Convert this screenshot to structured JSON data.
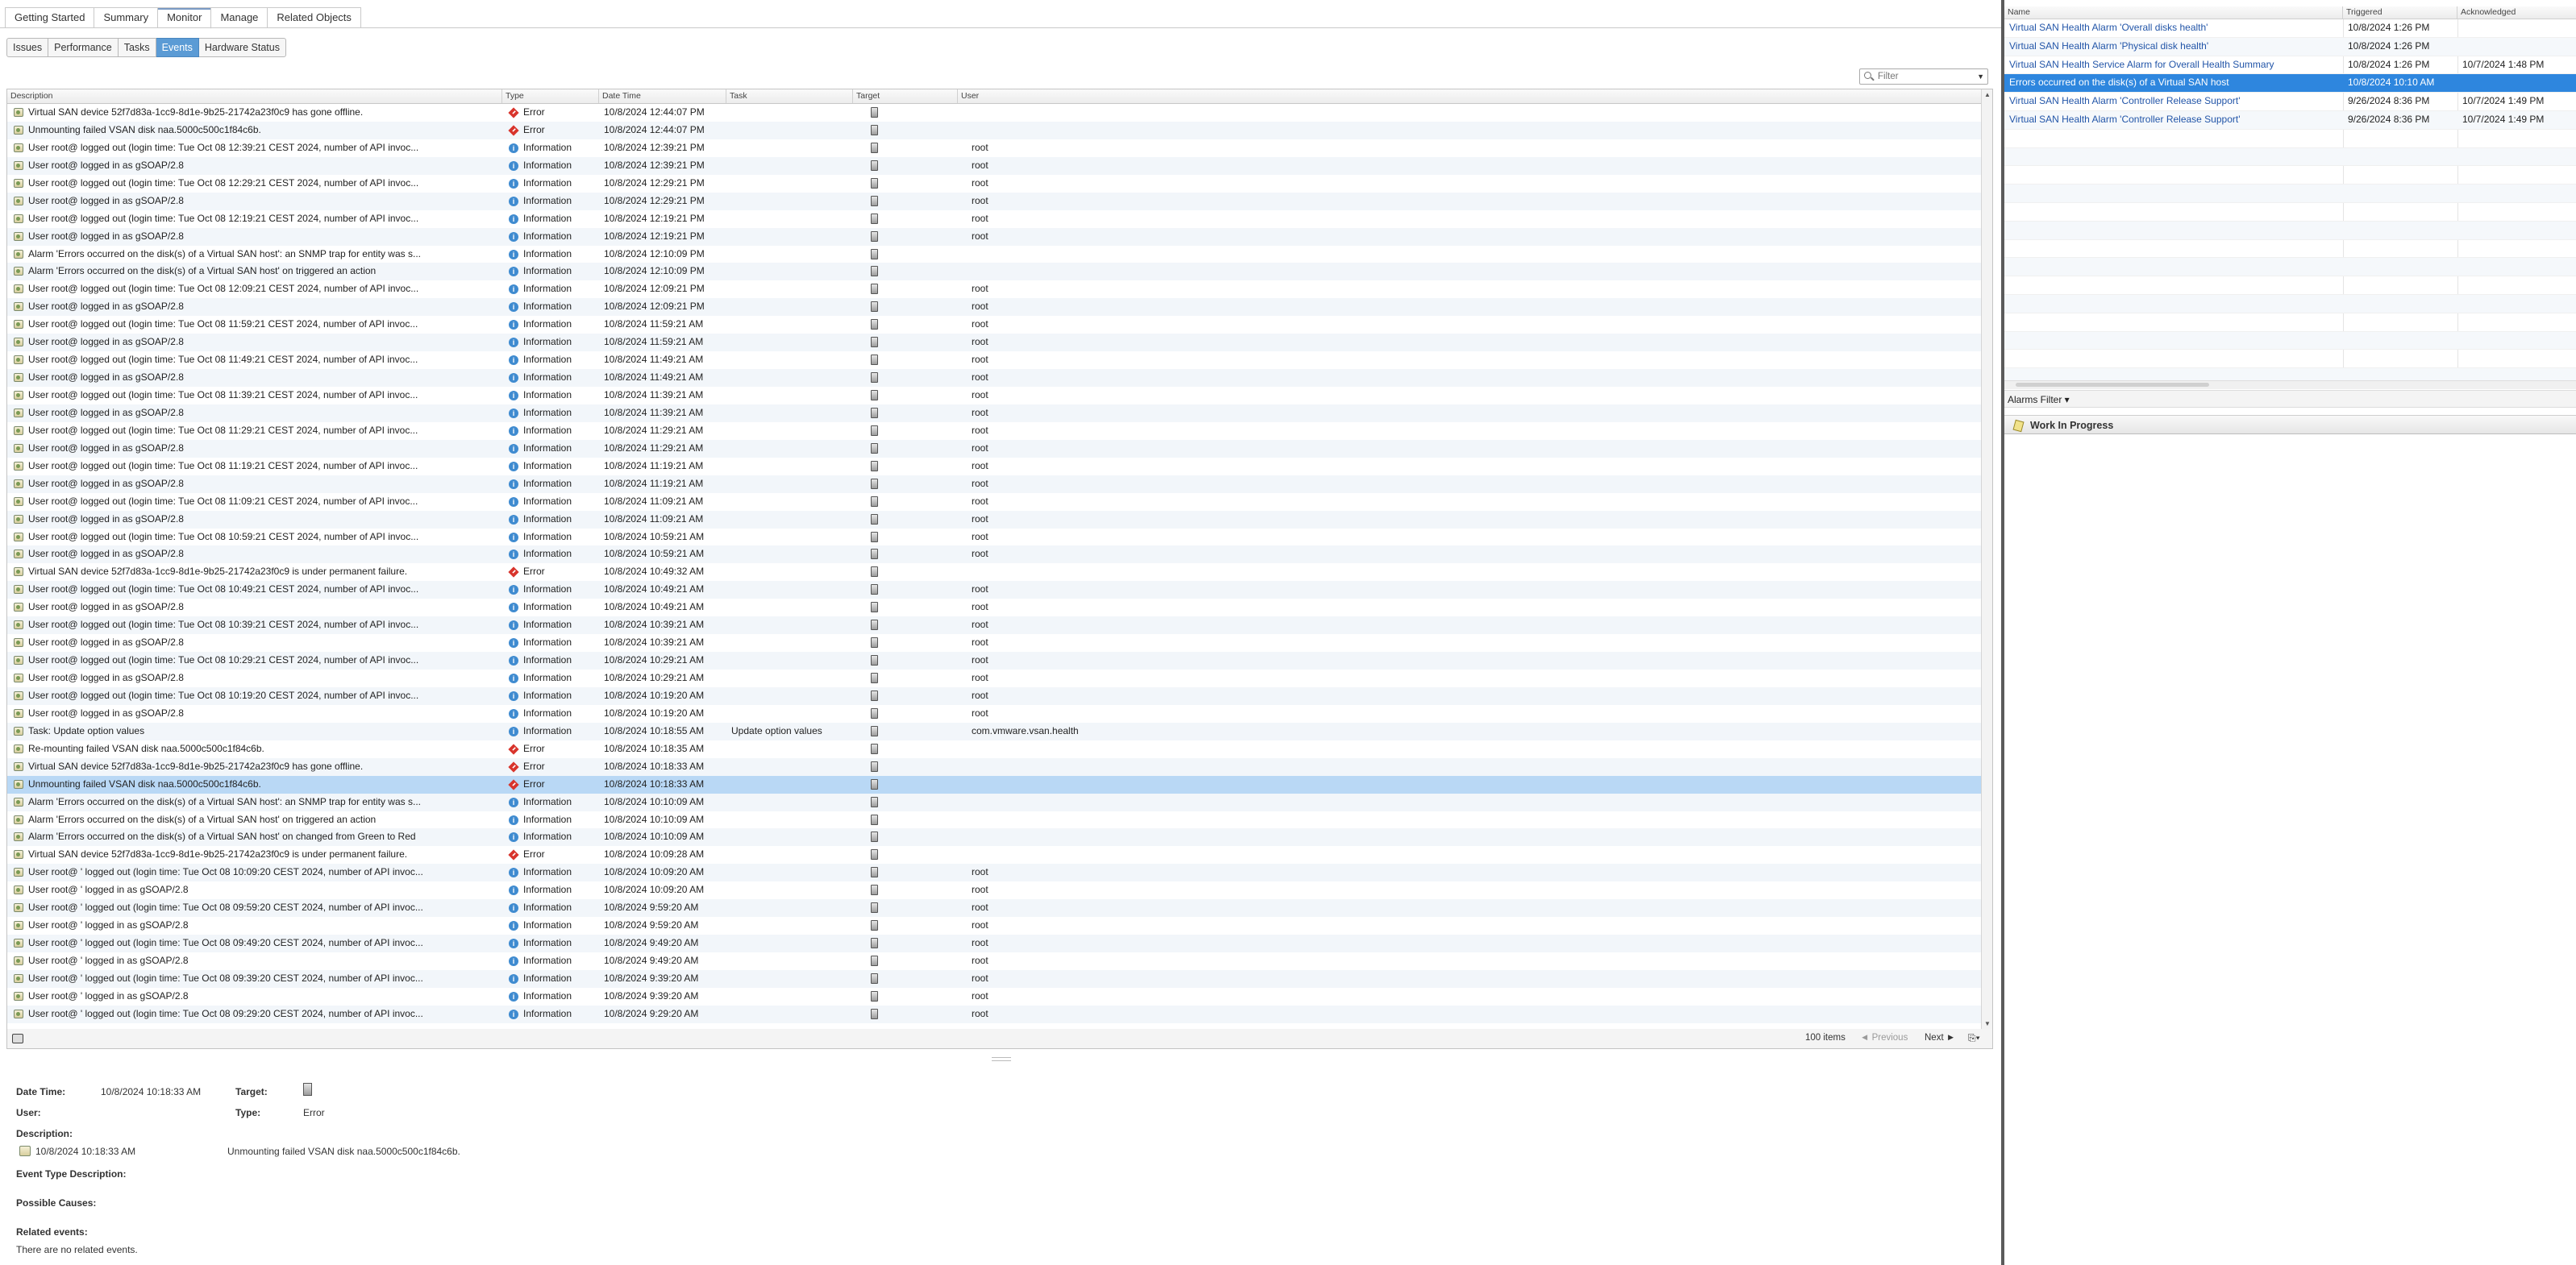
{
  "top_tabs": [
    "Getting Started",
    "Summary",
    "Monitor",
    "Manage",
    "Related Objects"
  ],
  "active_top_tab": "Monitor",
  "sub_tabs": [
    "Issues",
    "Performance",
    "Tasks",
    "Events",
    "Hardware Status"
  ],
  "active_sub_tab": "Events",
  "filter": {
    "placeholder": "Filter"
  },
  "events": {
    "columns": [
      "Description",
      "Type",
      "Date Time",
      "Task",
      "Target",
      "User"
    ],
    "rows": [
      {
        "desc": "Virtual SAN device 52f7d83a-1cc9-8d1e-9b25-21742a23f0c9 has gone offline.",
        "type": "Error",
        "date": "10/8/2024 12:44:07 PM",
        "task": "",
        "user": ""
      },
      {
        "desc": "Unmounting failed VSAN disk naa.5000c500c1f84c6b.",
        "type": "Error",
        "date": "10/8/2024 12:44:07 PM",
        "task": "",
        "user": ""
      },
      {
        "desc": "User root@                              logged out (login time: Tue Oct 08 12:39:21 CEST 2024, number of API invoc...",
        "type": "Information",
        "date": "10/8/2024 12:39:21 PM",
        "task": "",
        "user": "root"
      },
      {
        "desc": "User root@                              logged in as gSOAP/2.8",
        "type": "Information",
        "date": "10/8/2024 12:39:21 PM",
        "task": "",
        "user": "root"
      },
      {
        "desc": "User root@                              logged out (login time: Tue Oct 08 12:29:21 CEST 2024, number of API invoc...",
        "type": "Information",
        "date": "10/8/2024 12:29:21 PM",
        "task": "",
        "user": "root"
      },
      {
        "desc": "User root@                              logged in as gSOAP/2.8",
        "type": "Information",
        "date": "10/8/2024 12:29:21 PM",
        "task": "",
        "user": "root"
      },
      {
        "desc": "User root@                              logged out (login time: Tue Oct 08 12:19:21 CEST 2024, number of API invoc...",
        "type": "Information",
        "date": "10/8/2024 12:19:21 PM",
        "task": "",
        "user": "root"
      },
      {
        "desc": "User root@                              logged in as gSOAP/2.8",
        "type": "Information",
        "date": "10/8/2024 12:19:21 PM",
        "task": "",
        "user": "root"
      },
      {
        "desc": "Alarm 'Errors occurred on the disk(s) of a Virtual SAN host': an SNMP trap for entity                          was s...",
        "type": "Information",
        "date": "10/8/2024 12:10:09 PM",
        "task": "",
        "user": ""
      },
      {
        "desc": "Alarm 'Errors occurred on the disk(s) of a Virtual SAN host' on                              triggered an action",
        "type": "Information",
        "date": "10/8/2024 12:10:09 PM",
        "task": "",
        "user": ""
      },
      {
        "desc": "User root@                              logged out (login time: Tue Oct 08 12:09:21 CEST 2024, number of API invoc...",
        "type": "Information",
        "date": "10/8/2024 12:09:21 PM",
        "task": "",
        "user": "root"
      },
      {
        "desc": "User root@                              logged in as gSOAP/2.8",
        "type": "Information",
        "date": "10/8/2024 12:09:21 PM",
        "task": "",
        "user": "root"
      },
      {
        "desc": "User root@                              logged out (login time: Tue Oct 08 11:59:21 CEST 2024, number of API invoc...",
        "type": "Information",
        "date": "10/8/2024 11:59:21 AM",
        "task": "",
        "user": "root"
      },
      {
        "desc": "User root@                              logged in as gSOAP/2.8",
        "type": "Information",
        "date": "10/8/2024 11:59:21 AM",
        "task": "",
        "user": "root"
      },
      {
        "desc": "User root@                              logged out (login time: Tue Oct 08 11:49:21 CEST 2024, number of API invoc...",
        "type": "Information",
        "date": "10/8/2024 11:49:21 AM",
        "task": "",
        "user": "root"
      },
      {
        "desc": "User root@                              logged in as gSOAP/2.8",
        "type": "Information",
        "date": "10/8/2024 11:49:21 AM",
        "task": "",
        "user": "root"
      },
      {
        "desc": "User root@                              logged out (login time: Tue Oct 08 11:39:21 CEST 2024, number of API invoc...",
        "type": "Information",
        "date": "10/8/2024 11:39:21 AM",
        "task": "",
        "user": "root"
      },
      {
        "desc": "User root@                              logged in as gSOAP/2.8",
        "type": "Information",
        "date": "10/8/2024 11:39:21 AM",
        "task": "",
        "user": "root"
      },
      {
        "desc": "User root@                              logged out (login time: Tue Oct 08 11:29:21 CEST 2024, number of API invoc...",
        "type": "Information",
        "date": "10/8/2024 11:29:21 AM",
        "task": "",
        "user": "root"
      },
      {
        "desc": "User root@                              logged in as gSOAP/2.8",
        "type": "Information",
        "date": "10/8/2024 11:29:21 AM",
        "task": "",
        "user": "root"
      },
      {
        "desc": "User root@                              logged out (login time: Tue Oct 08 11:19:21 CEST 2024, number of API invoc...",
        "type": "Information",
        "date": "10/8/2024 11:19:21 AM",
        "task": "",
        "user": "root"
      },
      {
        "desc": "User root@                              logged in as gSOAP/2.8",
        "type": "Information",
        "date": "10/8/2024 11:19:21 AM",
        "task": "",
        "user": "root"
      },
      {
        "desc": "User root@                              logged out (login time: Tue Oct 08 11:09:21 CEST 2024, number of API invoc...",
        "type": "Information",
        "date": "10/8/2024 11:09:21 AM",
        "task": "",
        "user": "root"
      },
      {
        "desc": "User root@                              logged in as gSOAP/2.8",
        "type": "Information",
        "date": "10/8/2024 11:09:21 AM",
        "task": "",
        "user": "root"
      },
      {
        "desc": "User root@                              logged out (login time: Tue Oct 08 10:59:21 CEST 2024, number of API invoc...",
        "type": "Information",
        "date": "10/8/2024 10:59:21 AM",
        "task": "",
        "user": "root"
      },
      {
        "desc": "User root@                              logged in as gSOAP/2.8",
        "type": "Information",
        "date": "10/8/2024 10:59:21 AM",
        "task": "",
        "user": "root"
      },
      {
        "desc": "Virtual SAN device 52f7d83a-1cc9-8d1e-9b25-21742a23f0c9 is under permanent failure.",
        "type": "Error",
        "date": "10/8/2024 10:49:32 AM",
        "task": "",
        "user": ""
      },
      {
        "desc": "User root@                              logged out (login time: Tue Oct 08 10:49:21 CEST 2024, number of API invoc...",
        "type": "Information",
        "date": "10/8/2024 10:49:21 AM",
        "task": "",
        "user": "root"
      },
      {
        "desc": "User root@                              logged in as gSOAP/2.8",
        "type": "Information",
        "date": "10/8/2024 10:49:21 AM",
        "task": "",
        "user": "root"
      },
      {
        "desc": "User root@                              logged out (login time: Tue Oct 08 10:39:21 CEST 2024, number of API invoc...",
        "type": "Information",
        "date": "10/8/2024 10:39:21 AM",
        "task": "",
        "user": "root"
      },
      {
        "desc": "User root@                              logged in as gSOAP/2.8",
        "type": "Information",
        "date": "10/8/2024 10:39:21 AM",
        "task": "",
        "user": "root"
      },
      {
        "desc": "User root@                              logged out (login time: Tue Oct 08 10:29:21 CEST 2024, number of API invoc...",
        "type": "Information",
        "date": "10/8/2024 10:29:21 AM",
        "task": "",
        "user": "root"
      },
      {
        "desc": "User root@                              logged in as gSOAP/2.8",
        "type": "Information",
        "date": "10/8/2024 10:29:21 AM",
        "task": "",
        "user": "root"
      },
      {
        "desc": "User root@                              logged out (login time: Tue Oct 08 10:19:20 CEST 2024, number of API invoc...",
        "type": "Information",
        "date": "10/8/2024 10:19:20 AM",
        "task": "",
        "user": "root"
      },
      {
        "desc": "User root@                              logged in as gSOAP/2.8",
        "type": "Information",
        "date": "10/8/2024 10:19:20 AM",
        "task": "",
        "user": "root"
      },
      {
        "desc": "Task: Update option values",
        "type": "Information",
        "date": "10/8/2024 10:18:55 AM",
        "task": "Update option values",
        "user": "com.vmware.vsan.health"
      },
      {
        "desc": "Re-mounting failed VSAN disk naa.5000c500c1f84c6b.",
        "type": "Error",
        "date": "10/8/2024 10:18:35 AM",
        "task": "",
        "user": ""
      },
      {
        "desc": "Virtual SAN device 52f7d83a-1cc9-8d1e-9b25-21742a23f0c9 has gone offline.",
        "type": "Error",
        "date": "10/8/2024 10:18:33 AM",
        "task": "",
        "user": ""
      },
      {
        "desc": "Unmounting failed VSAN disk naa.5000c500c1f84c6b.",
        "type": "Error",
        "date": "10/8/2024 10:18:33 AM",
        "task": "",
        "user": "",
        "selected": true
      },
      {
        "desc": "Alarm 'Errors occurred on the disk(s) of a Virtual SAN host': an SNMP trap for entity                          was s...",
        "type": "Information",
        "date": "10/8/2024 10:10:09 AM",
        "task": "",
        "user": ""
      },
      {
        "desc": "Alarm 'Errors occurred on the disk(s) of a Virtual SAN host' on                              triggered an action",
        "type": "Information",
        "date": "10/8/2024 10:10:09 AM",
        "task": "",
        "user": ""
      },
      {
        "desc": "Alarm 'Errors occurred on the disk(s) of a Virtual SAN host' on                              changed from Green to Red",
        "type": "Information",
        "date": "10/8/2024 10:10:09 AM",
        "task": "",
        "user": ""
      },
      {
        "desc": "Virtual SAN device 52f7d83a-1cc9-8d1e-9b25-21742a23f0c9 is under permanent failure.",
        "type": "Error",
        "date": "10/8/2024 10:09:28 AM",
        "task": "",
        "user": ""
      },
      {
        "desc": "User root@                              ' logged out (login time: Tue Oct 08 10:09:20 CEST 2024, number of API invoc...",
        "type": "Information",
        "date": "10/8/2024 10:09:20 AM",
        "task": "",
        "user": "root"
      },
      {
        "desc": "User root@                              ' logged in as gSOAP/2.8",
        "type": "Information",
        "date": "10/8/2024 10:09:20 AM",
        "task": "",
        "user": "root"
      },
      {
        "desc": "User root@                              ' logged out (login time: Tue Oct 08 09:59:20 CEST 2024, number of API invoc...",
        "type": "Information",
        "date": "10/8/2024 9:59:20 AM",
        "task": "",
        "user": "root"
      },
      {
        "desc": "User root@                              ' logged in as gSOAP/2.8",
        "type": "Information",
        "date": "10/8/2024 9:59:20 AM",
        "task": "",
        "user": "root"
      },
      {
        "desc": "User root@                              ' logged out (login time: Tue Oct 08 09:49:20 CEST 2024, number of API invoc...",
        "type": "Information",
        "date": "10/8/2024 9:49:20 AM",
        "task": "",
        "user": "root"
      },
      {
        "desc": "User root@                              ' logged in as gSOAP/2.8",
        "type": "Information",
        "date": "10/8/2024 9:49:20 AM",
        "task": "",
        "user": "root"
      },
      {
        "desc": "User root@                              ' logged out (login time: Tue Oct 08 09:39:20 CEST 2024, number of API invoc...",
        "type": "Information",
        "date": "10/8/2024 9:39:20 AM",
        "task": "",
        "user": "root"
      },
      {
        "desc": "User root@                              ' logged in as gSOAP/2.8",
        "type": "Information",
        "date": "10/8/2024 9:39:20 AM",
        "task": "",
        "user": "root"
      },
      {
        "desc": "User root@                              ' logged out (login time: Tue Oct 08 09:29:20 CEST 2024, number of API invoc...",
        "type": "Information",
        "date": "10/8/2024 9:29:20 AM",
        "task": "",
        "user": "root"
      }
    ]
  },
  "footer": {
    "items": "100 items",
    "prev": "◄ Previous",
    "next": "Next ►"
  },
  "details": {
    "date_time_label": "Date Time:",
    "date_time_value": "10/8/2024 10:18:33 AM",
    "target_label": "Target:",
    "user_label": "User:",
    "type_label": "Type:",
    "type_value": "Error",
    "description_label": "Description:",
    "description_time": "10/8/2024 10:18:33 AM",
    "description_text": "Unmounting failed VSAN disk naa.5000c500c1f84c6b.",
    "event_type_label": "Event Type Description:",
    "possible_causes_label": "Possible Causes:",
    "related_events_label": "Related events:",
    "related_events_value": "There are no related events."
  },
  "alarms": {
    "columns": [
      "Name",
      "Triggered",
      "Acknowledged"
    ],
    "rows": [
      {
        "name": "Virtual SAN Health Alarm 'Overall disks health'",
        "triggered": "10/8/2024 1:26 PM",
        "ack": ""
      },
      {
        "name": "Virtual SAN Health Alarm 'Physical disk health'",
        "triggered": "10/8/2024 1:26 PM",
        "ack": ""
      },
      {
        "name": "Virtual SAN Health Service Alarm for Overall Health Summary",
        "triggered": "10/8/2024 1:26 PM",
        "ack": "10/7/2024 1:48 PM"
      },
      {
        "name": "Errors occurred on the disk(s) of a Virtual SAN host",
        "triggered": "10/8/2024 10:10 AM",
        "ack": "",
        "selected": true
      },
      {
        "name": "Virtual SAN Health Alarm 'Controller Release Support'",
        "triggered": "9/26/2024 8:36 PM",
        "ack": "10/7/2024 1:49 PM"
      },
      {
        "name": "Virtual SAN Health Alarm 'Controller Release Support'",
        "triggered": "9/26/2024 8:36 PM",
        "ack": "10/7/2024 1:49 PM"
      }
    ],
    "filter_label": "Alarms Filter ▾"
  },
  "work_in_progress": {
    "label": "Work In Progress"
  }
}
